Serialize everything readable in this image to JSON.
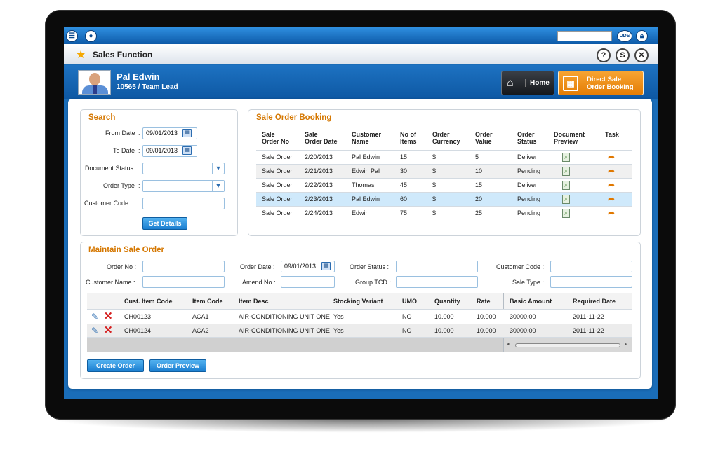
{
  "header": {
    "menu_icon": "menu-icon",
    "user_icon": "user-icon",
    "uds_label": "UDS",
    "lock_icon": "lock-icon",
    "title": "Sales Function",
    "help_label": "?",
    "refresh_label": "S",
    "close_label": "✕"
  },
  "user": {
    "name": "Pal Edwin",
    "role": "10565 / Team Lead"
  },
  "nav": {
    "home_label": "Home",
    "direct_sale_line1": "Direct Sale",
    "direct_sale_line2": "Order Booking"
  },
  "search": {
    "title": "Search",
    "from_date_label": "From Date",
    "from_date_value": "09/01/2013",
    "to_date_label": "To Date",
    "to_date_value": "09/01/2013",
    "document_status_label": "Document Status",
    "order_type_label": "Order Type",
    "customer_code_label": "Customer Code",
    "get_details_label": "Get Details"
  },
  "booking": {
    "title": "Sale Order Booking",
    "headers": [
      [
        "Sale",
        "Order No"
      ],
      [
        "Sale",
        "Order Date"
      ],
      [
        "Customer",
        "Name"
      ],
      [
        "No of",
        "Items"
      ],
      [
        "Order",
        "Currency"
      ],
      [
        "Order",
        "Value"
      ],
      [
        "Order",
        "Status"
      ],
      [
        "Document",
        "Preview"
      ],
      [
        "Task",
        ""
      ]
    ],
    "rows": [
      [
        "Sale Order",
        "2/20/2013",
        "Pal Edwin",
        "15",
        "$",
        "5",
        "Deliver"
      ],
      [
        "Sale Order",
        "2/21/2013",
        "Edwin Pal",
        "30",
        "$",
        "10",
        "Pending"
      ],
      [
        "Sale Order",
        "2/22/2013",
        "Thomas",
        "45",
        "$",
        "15",
        "Deliver"
      ],
      [
        "Sale Order",
        "2/23/2013",
        "Pal Edwin",
        "60",
        "$",
        "20",
        "Pending"
      ],
      [
        "Sale Order",
        "2/24/2013",
        "Edwin",
        "75",
        "$",
        "25",
        "Pending"
      ]
    ]
  },
  "maintain": {
    "title": "Maintain Sale Order",
    "order_no_label": "Order No :",
    "order_date_label": "Order Date :",
    "order_date_value": "09/01/2013",
    "order_status_label": "Order Status :",
    "customer_code_label": "Customer Code :",
    "customer_name_label": "Customer Name :",
    "amend_no_label": "Amend No :",
    "group_tcd_label": "Group TCD :",
    "sale_type_label": "Sale Type :",
    "headers": [
      "Cust. Item Code",
      "Item Code",
      "Item Desc",
      "Stocking Variant",
      "UMO",
      "Quantity",
      "Rate",
      "Basic Amount",
      "Required Date"
    ],
    "rows": [
      [
        "CH00123",
        "ACA1",
        "AIR-CONDITIONING UNIT ONE",
        "Yes",
        "NO",
        "10.000",
        "10.000",
        "30000.00",
        "2011-11-22"
      ],
      [
        "CH00124",
        "ACA2",
        "AIR-CONDITIONING UNIT ONE",
        "Yes",
        "NO",
        "10.000",
        "10.000",
        "30000.00",
        "2011-11-22"
      ]
    ],
    "create_order_label": "Create Order",
    "order_preview_label": "Order Preview"
  }
}
